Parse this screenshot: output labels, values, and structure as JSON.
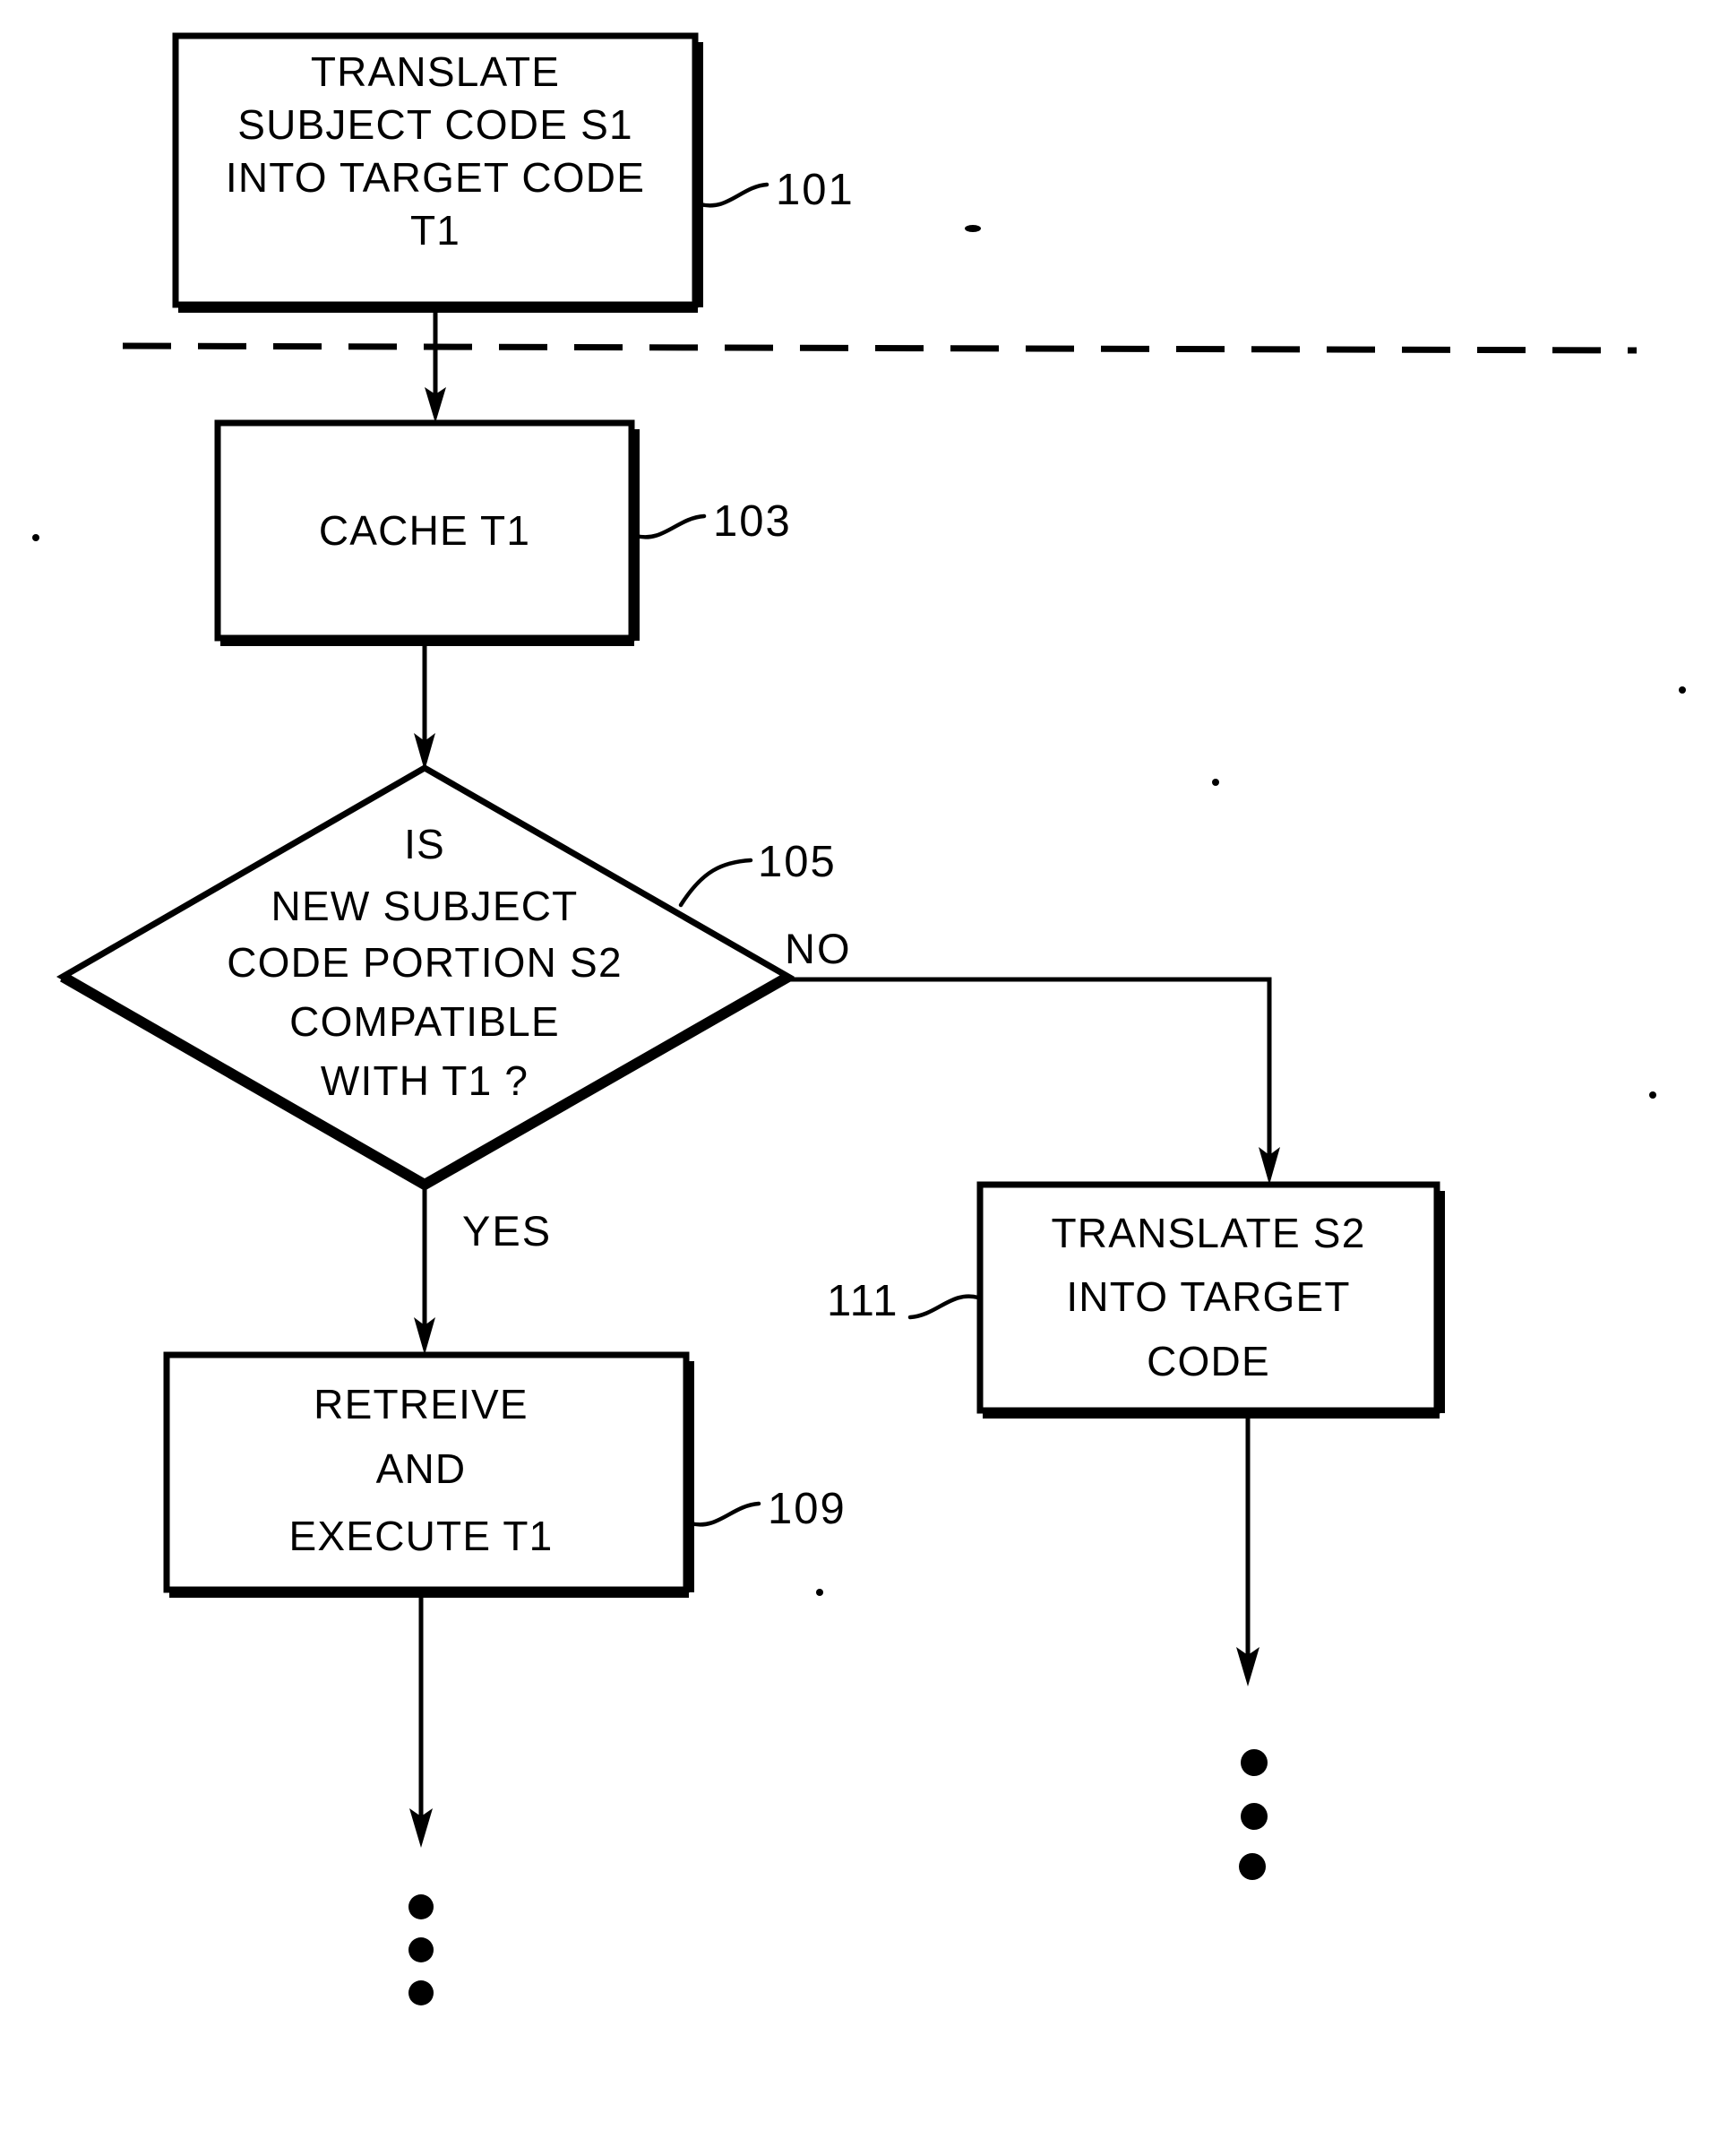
{
  "figure": {
    "title": "Flowchart of subject-to-target code translation and caching",
    "stroke_color": "#000000",
    "background_color": "#ffffff"
  },
  "nodes": [
    {
      "id": "step-101",
      "shape": "process-box",
      "ref": "101",
      "lines": [
        "TRANSLATE",
        "SUBJECT CODE S1",
        "INTO TARGET CODE",
        "T1"
      ]
    },
    {
      "id": "step-103",
      "shape": "process-box",
      "ref": "103",
      "lines": [
        "CACHE T1"
      ]
    },
    {
      "id": "step-105",
      "shape": "decision-diamond",
      "ref": "105",
      "lines": [
        "IS",
        "NEW SUBJECT",
        "CODE PORTION S2",
        "COMPATIBLE",
        "WITH T1 ?"
      ]
    },
    {
      "id": "step-109",
      "shape": "process-box",
      "ref": "109",
      "lines": [
        "RETREIVE",
        "AND",
        "EXECUTE T1"
      ]
    },
    {
      "id": "step-111",
      "shape": "process-box",
      "ref": "111",
      "lines": [
        "TRANSLATE  S2",
        "INTO TARGET",
        "CODE"
      ]
    }
  ],
  "branch_labels": {
    "no": "NO",
    "yes": "YES"
  },
  "separator": {
    "style": "dash-dot horizontal rule",
    "meaning": "phase boundary"
  },
  "continuation": {
    "left_branch_dots": 3,
    "right_branch_dots": 3
  }
}
